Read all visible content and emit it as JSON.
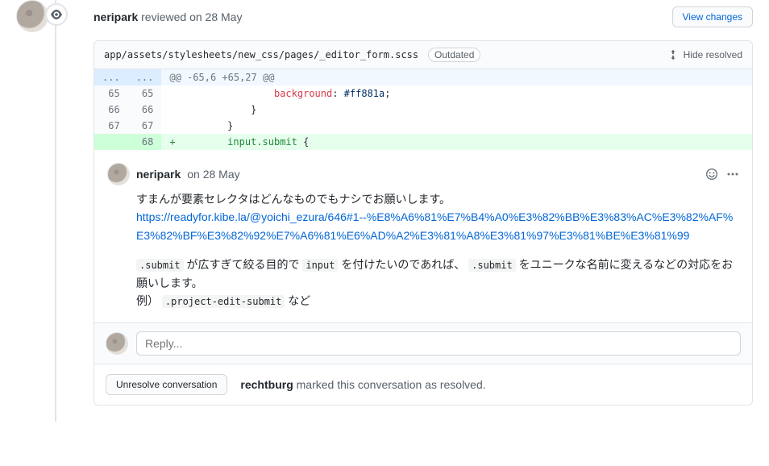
{
  "review": {
    "author": "neripark",
    "action": " reviewed ",
    "date_prefix": "on ",
    "date": "28 May",
    "view_changes_label": "View changes"
  },
  "file": {
    "path": "app/assets/stylesheets/new_css/pages/_editor_form.scss",
    "outdated_label": "Outdated",
    "hide_resolved_label": "Hide resolved"
  },
  "diff": {
    "hunk": {
      "left": "...",
      "right": "...",
      "text": "@@ -65,6 +65,27 @@"
    },
    "rows": [
      {
        "type": "ctx",
        "left": "65",
        "right": "65",
        "sign": " ",
        "html": "                <span class='kw'>background</span>: <span class='val'>#ff881a</span>;"
      },
      {
        "type": "ctx",
        "left": "66",
        "right": "66",
        "sign": " ",
        "html": "            }"
      },
      {
        "type": "ctx",
        "left": "67",
        "right": "67",
        "sign": " ",
        "html": "        }"
      },
      {
        "type": "add",
        "left": "",
        "right": "68",
        "sign": "+",
        "html": "        <span class='sel'>input</span><span class='sel'>.submit</span> {"
      }
    ]
  },
  "comment": {
    "author": "neripark",
    "date_prefix": "on ",
    "date": "28 May",
    "para1": "すまんが要素セレクタはどんなものでもナシでお願いします。",
    "link_text": "https://readyfor.kibe.la/@yoichi_ezura/646#1--%E8%A6%81%E7%B4%A0%E3%82%BB%E3%83%AC%E3%82%AF%E3%82%BF%E3%82%92%E7%A6%81%E6%AD%A2%E3%81%A8%E3%81%97%E3%81%BE%E3%81%99",
    "p2_seg1": " が広すぎて絞る目的で ",
    "p2_seg2": " を付けたいのであれば、 ",
    "p2_seg3": " をユニークな名前に変えるなどの対応をお願いします。",
    "code_submit": ".submit",
    "code_input": "input",
    "example_label": "例）",
    "code_example": ".project-edit-submit",
    "example_suffix": " など"
  },
  "reply": {
    "placeholder": "Reply..."
  },
  "resolve": {
    "unresolve_label": "Unresolve conversation",
    "resolved_by": "rechtburg",
    "resolved_suffix": " marked this conversation as resolved."
  }
}
